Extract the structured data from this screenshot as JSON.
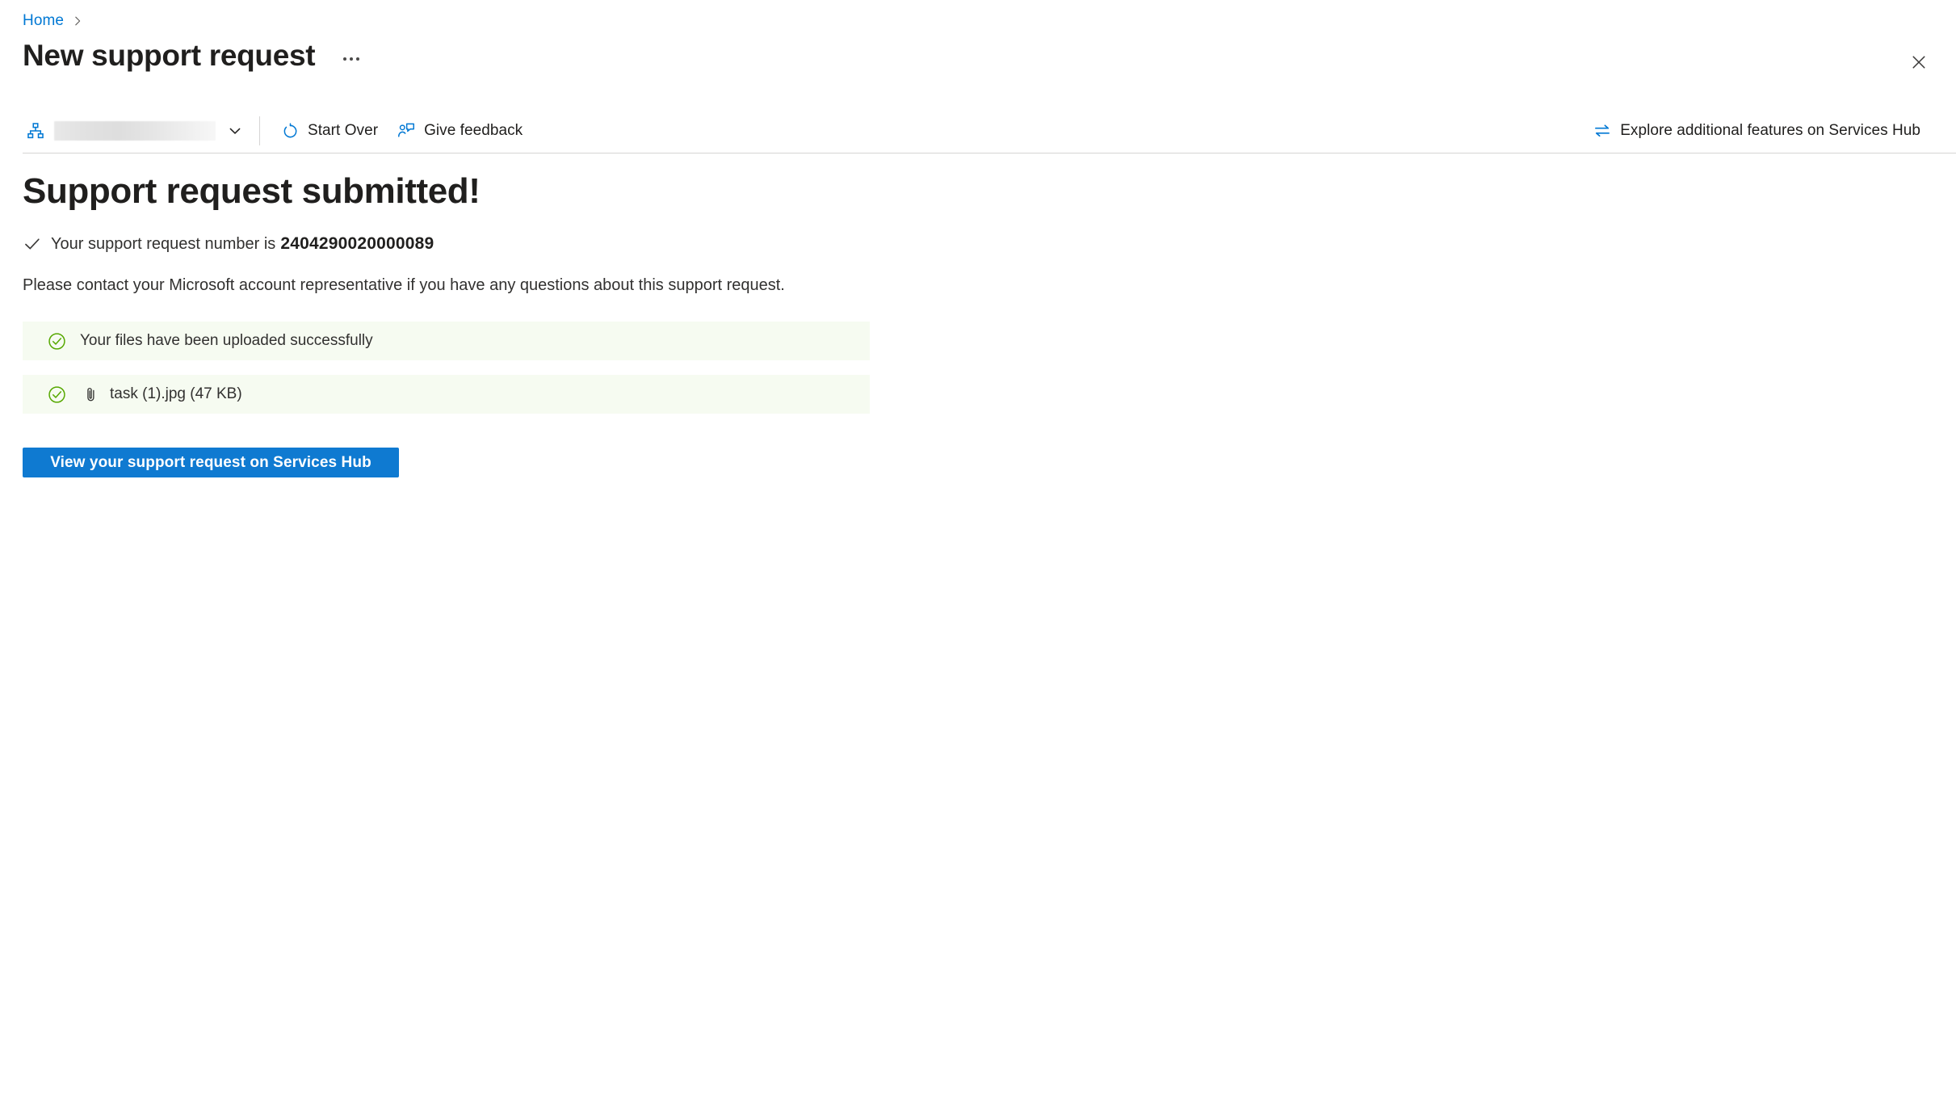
{
  "breadcrumb": {
    "items": [
      {
        "label": "Home",
        "icon": "home-link"
      }
    ],
    "separator": "chevron-right-icon"
  },
  "header": {
    "title": "New support request",
    "more_menu_label": "...",
    "close_label": "Close"
  },
  "commandbar": {
    "scope": {
      "icon": "org-hierarchy-icon",
      "value": "",
      "redacted": true,
      "chevron": "chevron-down-icon"
    },
    "buttons": [
      {
        "label": "Start Over",
        "icon": "refresh-icon"
      },
      {
        "label": "Give feedback",
        "icon": "person-feedback-icon"
      }
    ],
    "right_link": {
      "label": "Explore additional features on Services Hub",
      "icon": "swap-arrows-icon"
    }
  },
  "main": {
    "heading": "Support request submitted!",
    "ticket": {
      "check_icon": "checkmark-icon",
      "prefix": "Your support request number is",
      "number": "2404290020000089"
    },
    "contact_note": "Please contact your Microsoft account representative if you have any questions about this support request.",
    "upload_status": {
      "icon": "circle-check-icon",
      "message": "Your files have been uploaded successfully"
    },
    "attachments": [
      {
        "icon": "circle-check-icon",
        "attach_icon": "paperclip-icon",
        "name": "task (1).jpg (47 KB)"
      }
    ],
    "primary_button": {
      "label": "View your support request on Services Hub"
    }
  },
  "colors": {
    "accent": "#0078d4",
    "button": "#0f7ad1",
    "success_bg": "#f6fbf1",
    "success_green": "#56a800",
    "text": "#201f1e",
    "divider": "#d6d5d4"
  }
}
